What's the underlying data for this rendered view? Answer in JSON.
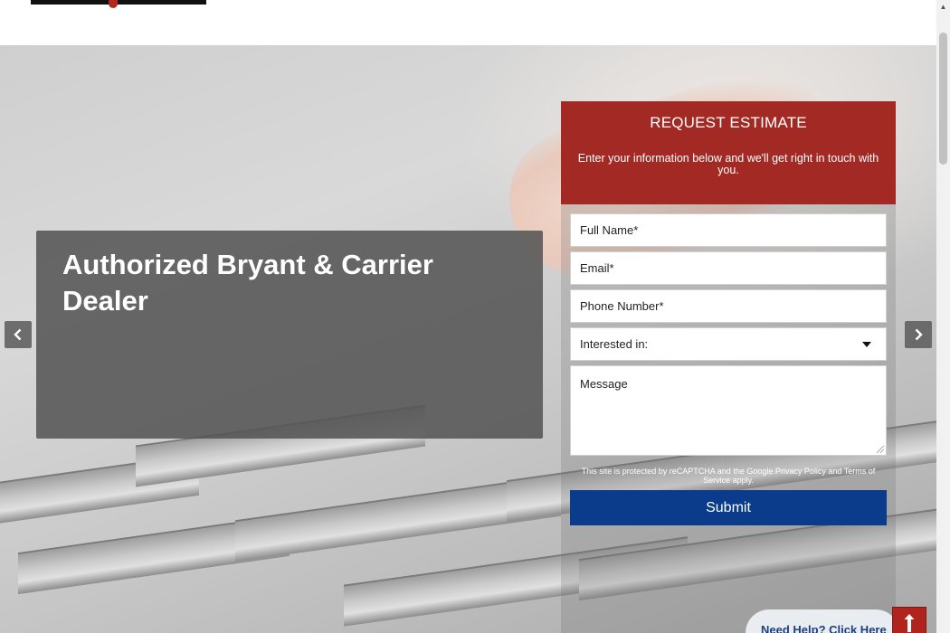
{
  "header": {
    "logo": "logo"
  },
  "hero": {
    "caption": "Authorized Bryant & Carrier Dealer",
    "prev_icon": "chevron-left-icon",
    "next_icon": "chevron-right-icon"
  },
  "form": {
    "title": "REQUEST ESTIMATE",
    "subtitle": "Enter your information below and we'll get right in touch with you.",
    "full_name_placeholder": "Full Name*",
    "email_placeholder": "Email*",
    "phone_placeholder": "Phone Number*",
    "interest_selected": "Interested in:",
    "message_placeholder": "Message",
    "recaptcha": "This site is protected by reCAPTCHA and the Google Privacy Policy and Terms of Service apply.",
    "submit_label": "Submit"
  },
  "help": {
    "label": "Need Help? Click Here"
  },
  "colors": {
    "brand_red": "#a32a24",
    "submit_blue": "#0b3c8c",
    "help_text": "#1d3f79"
  }
}
